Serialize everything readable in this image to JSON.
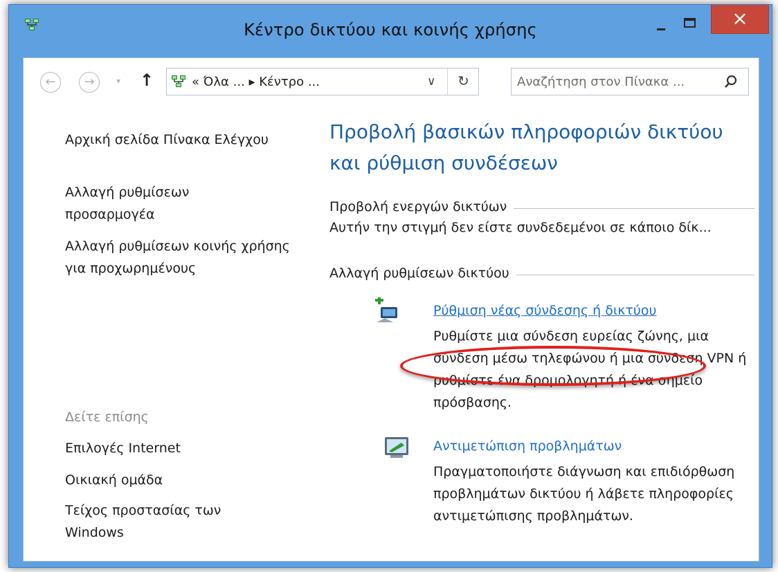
{
  "window": {
    "title": "Κέντρο δικτύου και κοινής χρήσης",
    "close_glyph": "×",
    "accent": "#5fa0e0",
    "close_color": "#c7483a"
  },
  "addressbar": {
    "back_glyph": "←",
    "forward_glyph": "→",
    "recent_glyph": "▾",
    "up_glyph": "↑",
    "path": "« Όλα ... ▸ Κέντρο ...",
    "dropdown_glyph": "∨",
    "refresh_glyph": "↻",
    "search_placeholder": "Αναζήτηση στον Πίνακα ..."
  },
  "sidebar": {
    "links": [
      {
        "label": "Αρχική σελίδα Πίνακα Ελέγχου"
      },
      {
        "label": "Αλλαγή ρυθμίσεων προσαρμογέα"
      },
      {
        "label": "Αλλαγή ρυθμίσεων κοινής χρήσης για προχωρημένους"
      }
    ],
    "see_also_caption": "Δείτε επίσης",
    "see_also": [
      {
        "label": "Επιλογές Internet"
      },
      {
        "label": "Οικιακή ομάδα"
      },
      {
        "label": "Τείχος προστασίας των Windows"
      }
    ]
  },
  "main": {
    "heading": "Προβολή βασικών πληροφοριών δικτύου και ρύθμιση συνδέσεων",
    "active_networks": {
      "title": "Προβολή ενεργών δικτύων",
      "status": "Αυτήν την στιγμή δεν είστε συνδεδεμένοι σε κάποιο δίκ..."
    },
    "change_settings": {
      "title": "Αλλαγή ρυθμίσεων δικτύου",
      "tasks": [
        {
          "icon": "new-connection-icon",
          "label": "Ρύθμιση νέας σύνδεσης ή δικτύου",
          "description": "Ρυθμίστε μια σύνδεση ευρείας ζώνης, μια σύνδεση μέσω τηλεφώνου ή μια σύνδεση VPN ή ρυθμίστε ένα δρομολογητή ή ένα σημείο πρόσβασης."
        },
        {
          "icon": "troubleshoot-icon",
          "label": "Αντιμετώπιση προβλημάτων",
          "description": "Πραγματοποιήστε διάγνωση και επιδιόρθωση προβλημάτων δικτύου ή λάβετε πληροφορίες αντιμετώπισης προβλημάτων."
        }
      ]
    }
  }
}
